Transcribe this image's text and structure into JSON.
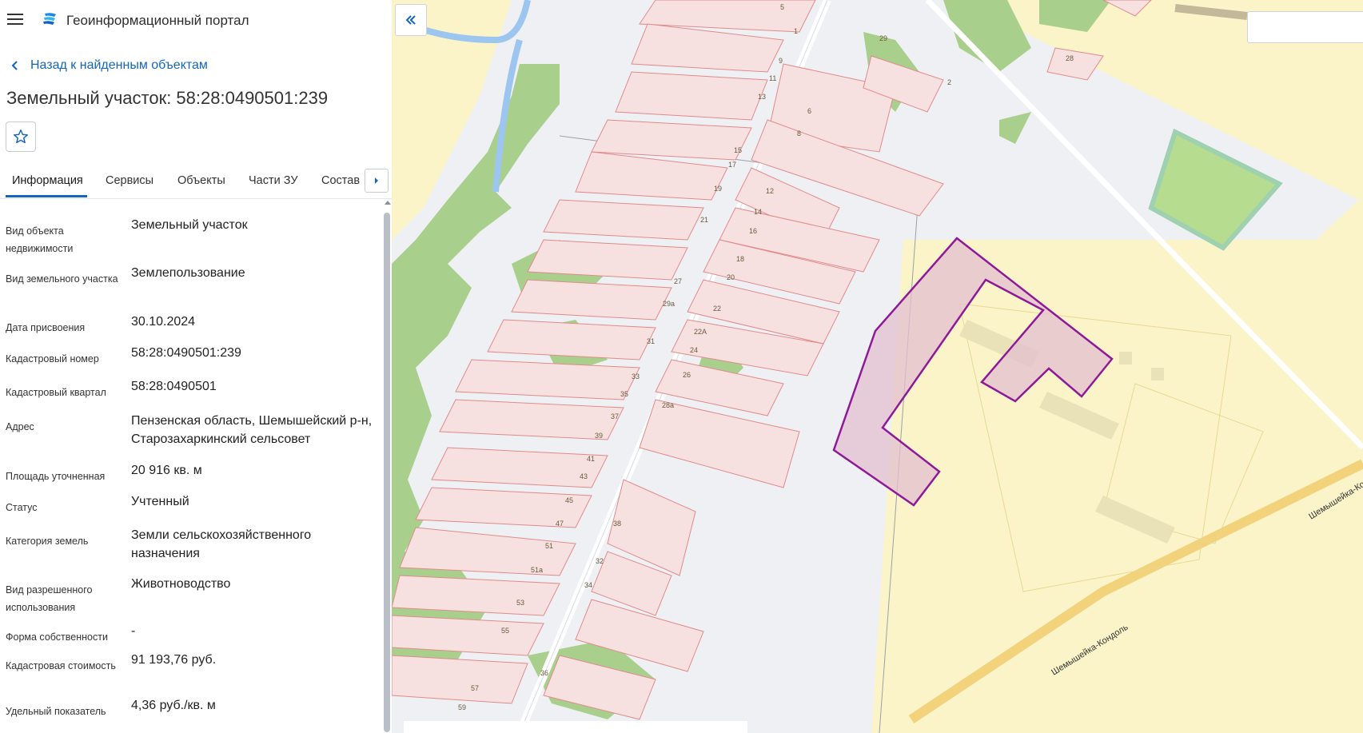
{
  "header": {
    "title": "Геоинформационный портал",
    "menu_icon": "menu-icon",
    "logo_icon": "portal-logo-icon"
  },
  "back_link": {
    "label": "Назад к найденным объектам",
    "icon": "chevron-left-icon"
  },
  "object_title": "Земельный участок: 58:28:0490501:239",
  "favorite_icon": "star-outline-icon",
  "tabs": [
    {
      "label": "Информация",
      "active": true
    },
    {
      "label": "Сервисы"
    },
    {
      "label": "Объекты"
    },
    {
      "label": "Части ЗУ"
    },
    {
      "label": "Состав"
    }
  ],
  "properties": [
    {
      "label": "Вид объекта недвижимости",
      "value": "Земельный участок"
    },
    {
      "label": "Вид земельного участка",
      "value": "Землепользование"
    },
    {
      "label": "Дата присвоения",
      "value": "30.10.2024"
    },
    {
      "label": "Кадастровый номер",
      "value": "58:28:0490501:239"
    },
    {
      "label": "Кадастровый квартал",
      "value": "58:28:0490501"
    },
    {
      "label": "Адрес",
      "value": "Пензенская область, Шемышейский р-н, Старозахаркинский сельсовет"
    },
    {
      "label": "Площадь уточненная",
      "value": "20 916 кв. м"
    },
    {
      "label": "Статус",
      "value": "Учтенный"
    },
    {
      "label": "Категория земель",
      "value": "Земли сельскохозяйственного назначения"
    },
    {
      "label": "Вид разрешенного использования",
      "value": "Животноводство"
    },
    {
      "label": "Форма собственности",
      "value": "-"
    },
    {
      "label": "Кадастровая стоимость",
      "value": "91 193,76 руб."
    },
    {
      "label": "Удельный показатель",
      "value": "4,36 руб./кв. м"
    }
  ],
  "map": {
    "road_label": "Шемышейка-Кондоль",
    "road_label_2": "Шемышейка-Ко",
    "parcel_numbers": [
      "5",
      "1",
      "9",
      "11",
      "13",
      "15",
      "17",
      "19",
      "21",
      "27",
      "29а",
      "31",
      "33",
      "35",
      "37",
      "39",
      "41",
      "43",
      "45",
      "47",
      "51",
      "51а",
      "53",
      "55",
      "57",
      "59",
      "29",
      "2",
      "28",
      "6",
      "8",
      "12",
      "14",
      "16",
      "18",
      "20",
      "22",
      "22А",
      "24",
      "26",
      "28а",
      "38",
      "32",
      "34",
      "36"
    ],
    "colors": {
      "selected_parcel": "#8e1a9a",
      "parcel_outline": "#e28a8a",
      "parcel_fill": "#f6e0e0",
      "vegetation": "#a9cf8d",
      "water": "#9cc6f0",
      "farmland": "#fbf4c8",
      "road": "#f2d27a"
    }
  },
  "ui": {
    "collapse_icon": "double-chevron-left-icon",
    "tabs_next_icon": "chevron-right-icon"
  }
}
